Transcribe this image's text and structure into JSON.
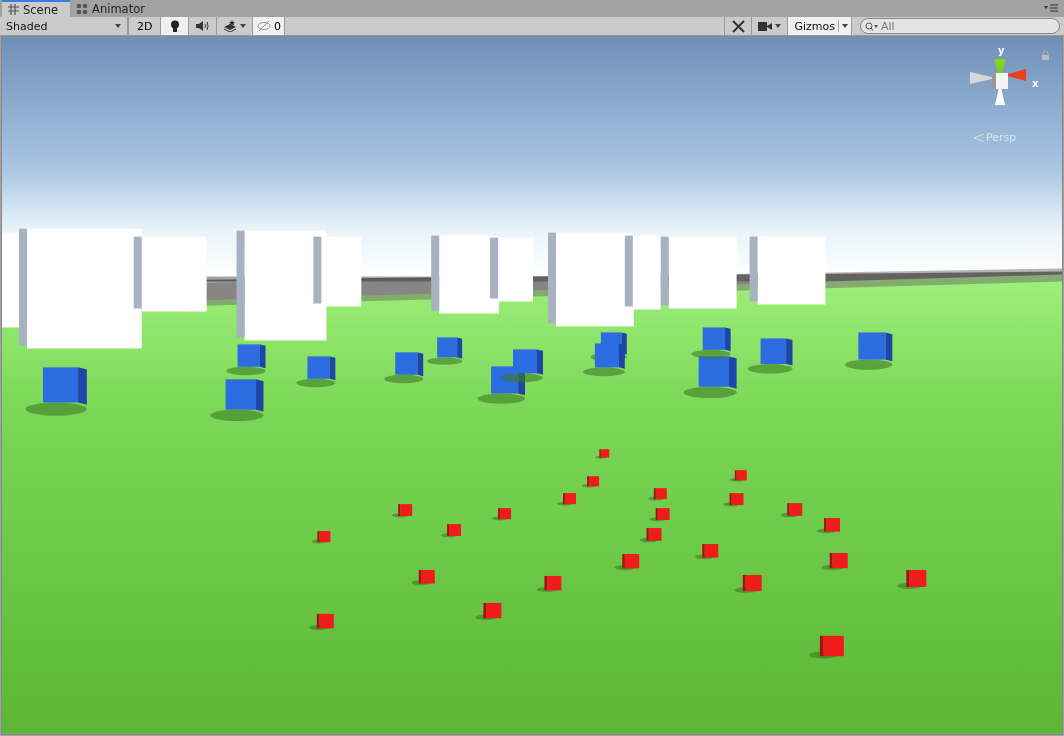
{
  "tabs": [
    {
      "label": "Scene",
      "selected": true
    },
    {
      "label": "Animator",
      "selected": false
    }
  ],
  "toolbar": {
    "shading_mode": "Shaded",
    "mode_2d": {
      "label": "2D",
      "selected": false
    },
    "lighting": {
      "on": true
    },
    "audio": {
      "on": false
    },
    "effects": {
      "on": false
    },
    "hidden_count": "0",
    "gizmos": "Gizmos",
    "search": {
      "placeholder": "All"
    }
  },
  "gizmo": {
    "y_label": "y",
    "x_label": "x",
    "projection": "Persp",
    "locked": false
  }
}
